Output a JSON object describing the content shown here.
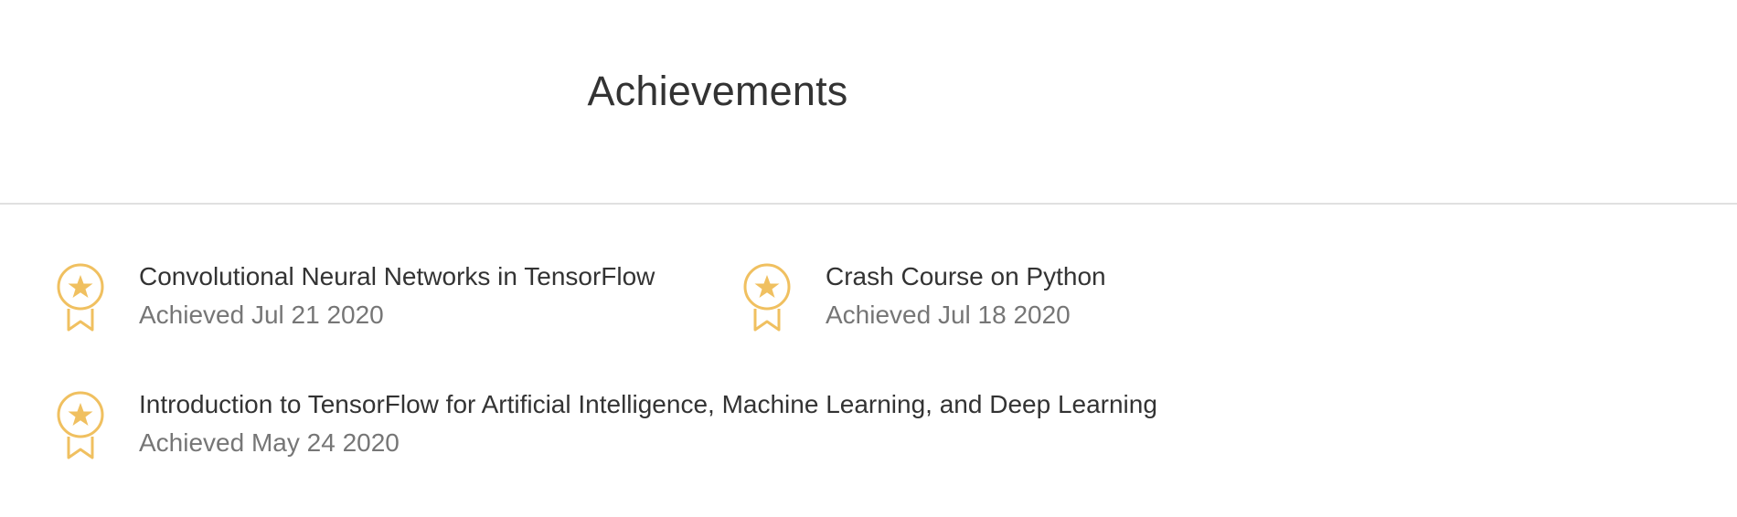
{
  "header": {
    "title": "Achievements"
  },
  "achievements": [
    {
      "title": "Convolutional Neural Networks in TensorFlow",
      "date": "Achieved Jul 21 2020",
      "icon": "award-ribbon-icon"
    },
    {
      "title": "Crash Course on Python",
      "date": "Achieved Jul 18 2020",
      "icon": "award-ribbon-icon"
    },
    {
      "title": "Introduction to TensorFlow for Artificial Intelligence, Machine Learning, and Deep Learning",
      "date": "Achieved May 24 2020",
      "icon": "award-ribbon-icon"
    }
  ],
  "colors": {
    "accent": "#f0c060",
    "title_text": "#333333",
    "date_text": "#767676",
    "divider": "#e0e0e0"
  }
}
